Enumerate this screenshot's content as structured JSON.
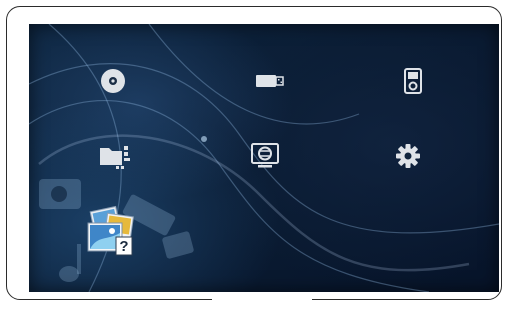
{
  "device": {
    "screen_background": "dark blue swirl",
    "accent_color": "#d9dde3"
  },
  "menu": {
    "items": [
      {
        "id": "disc",
        "icon": "disc-icon"
      },
      {
        "id": "usb",
        "icon": "usb-drive-icon"
      },
      {
        "id": "music-player",
        "icon": "music-player-icon"
      },
      {
        "id": "media-library",
        "icon": "media-library-icon"
      },
      {
        "id": "network",
        "icon": "network-tv-icon"
      },
      {
        "id": "settings",
        "icon": "gear-icon"
      }
    ],
    "selected": {
      "id": "unknown-media",
      "icon": "photo-unknown-icon",
      "badge": "?"
    }
  }
}
